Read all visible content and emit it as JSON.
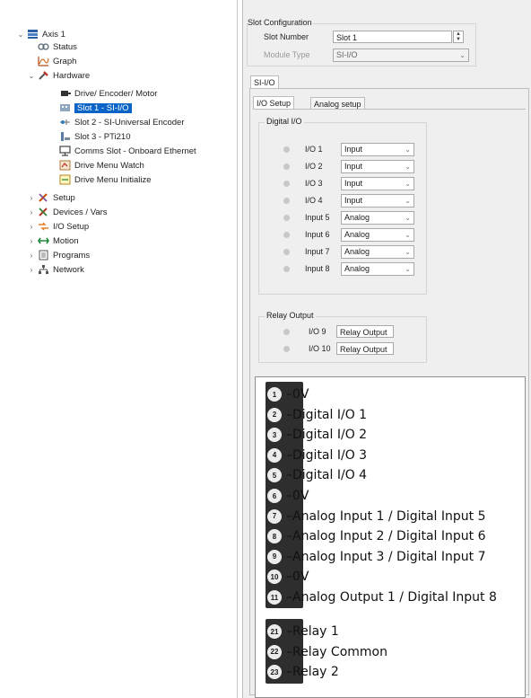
{
  "tree": {
    "axis": "Axis 1",
    "status": "Status",
    "graph": "Graph",
    "hardware": "Hardware",
    "drive": "Drive/ Encoder/ Motor",
    "slot1": "Slot 1 - SI-I/O",
    "slot2": "Slot 2 - SI-Universal Encoder",
    "slot3": "Slot 3 - PTi210",
    "comms": "Comms Slot - Onboard Ethernet",
    "menu_watch": "Drive Menu Watch",
    "menu_init": "Drive Menu Initialize",
    "setup": "Setup",
    "devices": "Devices / Vars",
    "io_setup": "I/O Setup",
    "motion": "Motion",
    "programs": "Programs",
    "network": "Network"
  },
  "slot_config": {
    "group_title": "Slot Configuration",
    "slot_number_label": "Slot Number",
    "slot_number_value": "Slot 1",
    "module_type_label": "Module Type",
    "module_type_value": "SI-I/O"
  },
  "outer_tab": "SI-I/O",
  "tabs": {
    "io_setup": "I/O Setup",
    "analog_setup": "Analog setup"
  },
  "digital_io": {
    "title": "Digital I/O",
    "rows": [
      {
        "label": "I/O 1",
        "value": "Input"
      },
      {
        "label": "I/O 2",
        "value": "Input"
      },
      {
        "label": "I/O 3",
        "value": "Input"
      },
      {
        "label": "I/O 4",
        "value": "Input"
      },
      {
        "label": "Input 5",
        "value": "Analog"
      },
      {
        "label": "Input 6",
        "value": "Analog"
      },
      {
        "label": "Input 7",
        "value": "Analog"
      },
      {
        "label": "Input 8",
        "value": "Analog"
      }
    ]
  },
  "relay_output": {
    "title": "Relay Output",
    "rows": [
      {
        "label": "I/O 9",
        "value": "Relay Output"
      },
      {
        "label": "I/O 10",
        "value": "Relay Output"
      }
    ]
  },
  "pins": [
    {
      "num": "1",
      "text": "0V"
    },
    {
      "num": "2",
      "text": "Digital I/O 1"
    },
    {
      "num": "3",
      "text": "Digital I/O 2"
    },
    {
      "num": "4",
      "text": "Digital I/O 3"
    },
    {
      "num": "5",
      "text": "Digital I/O 4"
    },
    {
      "num": "6",
      "text": "0V"
    },
    {
      "num": "7",
      "text": "Analog Input 1 / Digital Input 5"
    },
    {
      "num": "8",
      "text": "Analog Input 2 / Digital Input 6"
    },
    {
      "num": "9",
      "text": "Analog Input 3 / Digital Input 7"
    },
    {
      "num": "10",
      "text": "0V"
    },
    {
      "num": "11",
      "text": "Analog Output 1 / Digital Input 8"
    }
  ],
  "relay_pins": [
    {
      "num": "21",
      "text": "Relay 1"
    },
    {
      "num": "22",
      "text": "Relay Common"
    },
    {
      "num": "23",
      "text": "Relay 2"
    }
  ],
  "colors": {
    "selection": "#0a64c8",
    "panel": "#efefef",
    "terminal": "#2e2e2e"
  }
}
